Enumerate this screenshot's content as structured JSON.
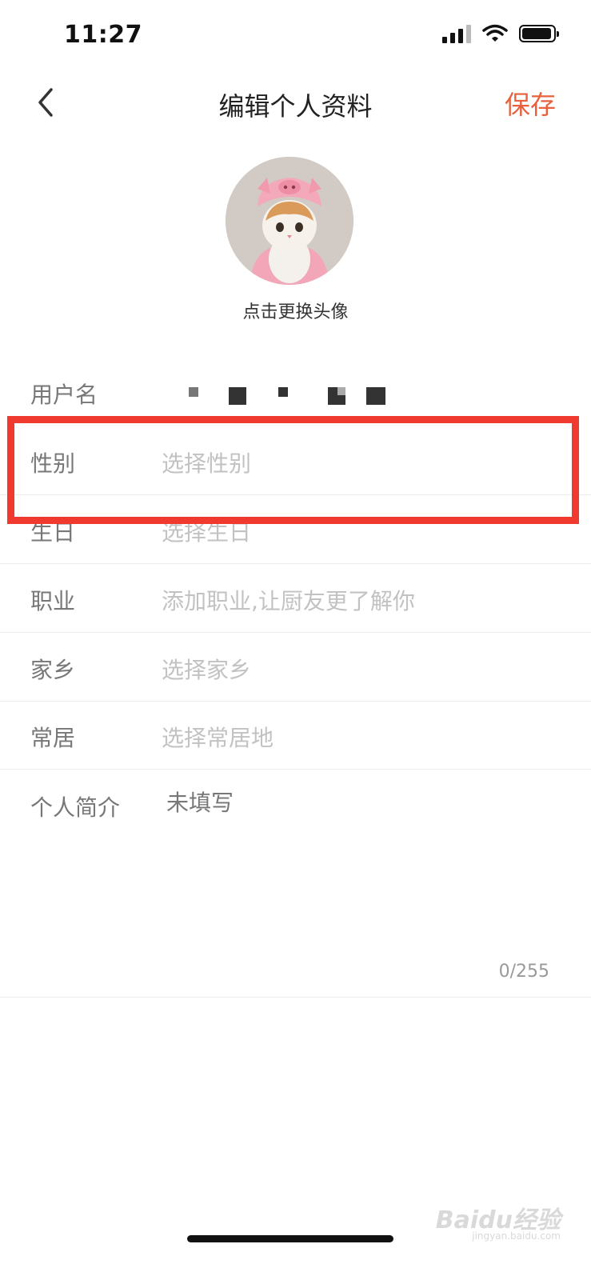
{
  "status_bar": {
    "time": "11:27"
  },
  "header": {
    "title": "编辑个人资料",
    "save_label": "保存"
  },
  "avatar": {
    "hint": "点击更换头像"
  },
  "form": {
    "username": {
      "label": "用户名"
    },
    "gender": {
      "label": "性别",
      "placeholder": "选择性别"
    },
    "birthday": {
      "label": "生日",
      "placeholder": "选择生日"
    },
    "occupation": {
      "label": "职业",
      "placeholder": "添加职业,让厨友更了解你"
    },
    "hometown": {
      "label": "家乡",
      "placeholder": "选择家乡"
    },
    "residence": {
      "label": "常居",
      "placeholder": "选择常居地"
    },
    "bio": {
      "label": "个人简介",
      "value": "未填写",
      "counter": "0/255"
    }
  },
  "watermark": {
    "text": "Baidu经验",
    "sub": "jingyan.baidu.com"
  },
  "colors": {
    "accent": "#e8603c",
    "highlight": "#f03a30"
  }
}
